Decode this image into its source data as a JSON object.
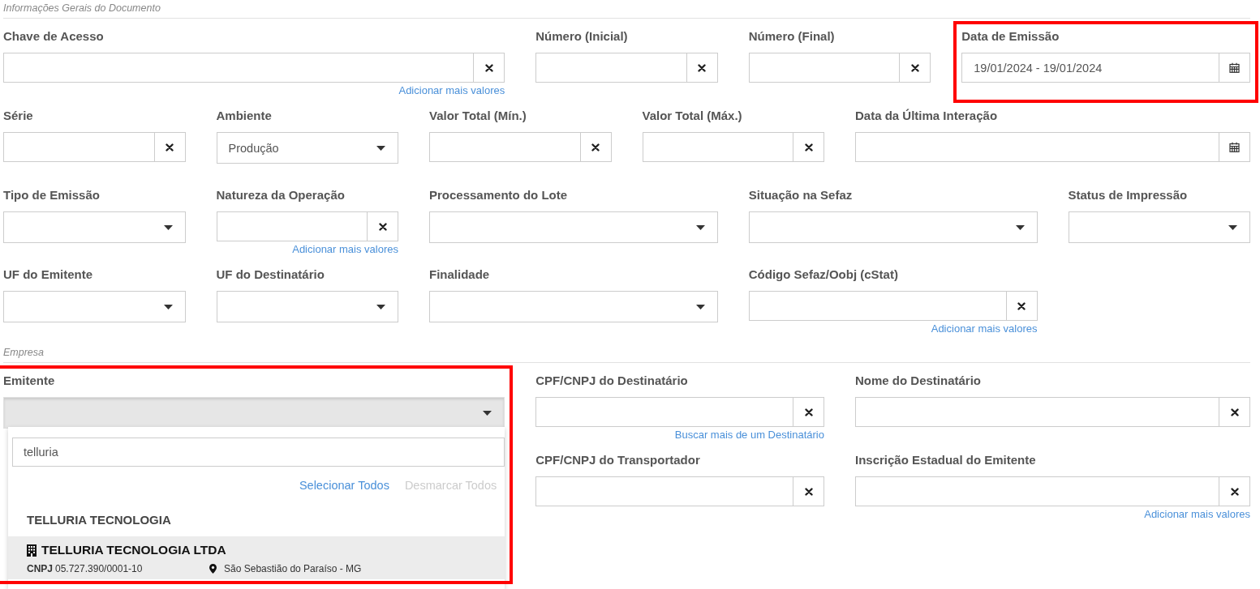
{
  "sections": [
    {
      "title": "Informações Gerais do Documento",
      "rows": [
        {
          "fields": [
            {
              "label": "Chave de Acesso",
              "kind": "clear",
              "link": "Adicionar mais valores",
              "highlighted": false
            },
            {
              "label": "Número (Inicial)",
              "kind": "clear",
              "highlighted": false
            },
            {
              "label": "Número (Final)",
              "kind": "clear",
              "highlighted": false
            },
            {
              "label": "Data de Emissão",
              "kind": "date",
              "value": "19/01/2024 - 19/01/2024",
              "highlighted": true
            }
          ]
        },
        {
          "fields": [
            {
              "label": "Série",
              "kind": "clear",
              "highlighted": false
            },
            {
              "label": "Ambiente",
              "kind": "select",
              "value": "Produção",
              "highlighted": false
            },
            {
              "label": "Valor Total (Mín.)",
              "kind": "clear",
              "highlighted": false
            },
            {
              "label": "Valor Total (Máx.)",
              "kind": "clear",
              "highlighted": false
            },
            {
              "label": "Data da Última Interação",
              "kind": "date",
              "highlighted": false
            }
          ]
        },
        {
          "fields": [
            {
              "label": "Tipo de Emissão",
              "kind": "select",
              "highlighted": false
            },
            {
              "label": "Natureza da Operação",
              "kind": "clear",
              "link": "Adicionar mais valores",
              "highlighted": false
            },
            {
              "label": "Processamento do Lote",
              "kind": "select",
              "highlighted": false
            },
            {
              "label": "Situação na Sefaz",
              "kind": "select",
              "highlighted": false
            },
            {
              "label": "Status de Impressão",
              "kind": "select",
              "highlighted": false
            }
          ]
        },
        {
          "fields": [
            {
              "label": "UF do Emitente",
              "kind": "select",
              "highlighted": false
            },
            {
              "label": "UF do Destinatário",
              "kind": "select",
              "highlighted": false
            },
            {
              "label": "Finalidade",
              "kind": "select",
              "highlighted": false
            },
            {
              "label": "Código Sefaz/Oobj (cStat)",
              "kind": "clear",
              "link": "Adicionar mais valores",
              "highlighted": false
            }
          ]
        }
      ]
    },
    {
      "title": "Empresa",
      "rows": [
        {
          "fields": [
            {
              "label": "Emitente",
              "kind": "multiselect",
              "open": true,
              "highlighted": true,
              "dropdown": {
                "search_value": "telluria",
                "actions": [
                  {
                    "label": "Selecionar Todos",
                    "disabled": false
                  },
                  {
                    "label": "Desmarcar Todos",
                    "disabled": true
                  }
                ],
                "groups": [
                  {
                    "label": "TELLURIA TECNOLOGIA",
                    "options": [
                      {
                        "name": "TELLURIA TECNOLOGIA LTDA",
                        "id_label": "CNPJ",
                        "id_value": "05.727.390/0001-10",
                        "location": "São Sebastião do Paraíso - MG",
                        "active": true
                      }
                    ]
                  }
                ]
              }
            },
            {
              "label": "CPF/CNPJ do Destinatário",
              "kind": "clear",
              "link": "Buscar mais de um Destinatário",
              "highlighted": false
            },
            {
              "label": "Nome do Destinatário",
              "kind": "clear",
              "highlighted": false
            }
          ]
        },
        {
          "fields": [
            {
              "label": "CPF/CNPJ do Transportador",
              "kind": "clear",
              "highlighted": false
            },
            {
              "label": "Inscrição Estadual do Emitente",
              "kind": "clear",
              "link": "Adicionar mais valores",
              "highlighted": false
            }
          ]
        }
      ]
    }
  ]
}
